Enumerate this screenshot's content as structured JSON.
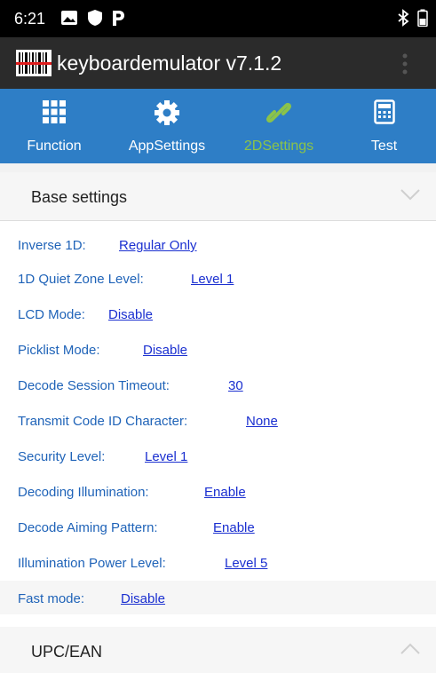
{
  "status_bar": {
    "time": "6:21"
  },
  "app_bar": {
    "title": "keyboardemulator v7.1.2"
  },
  "tabs": [
    {
      "label": "Function",
      "icon": "grid-icon",
      "active": false
    },
    {
      "label": "AppSettings",
      "icon": "gear-icon",
      "active": false
    },
    {
      "label": "2DSettings",
      "icon": "link-icon",
      "active": true
    },
    {
      "label": "Test",
      "icon": "calculator-icon",
      "active": false
    }
  ],
  "sections": [
    {
      "title": "Base settings",
      "expanded": true
    },
    {
      "title": "UPC/EAN",
      "expanded": false
    }
  ],
  "settings": [
    {
      "label": "Inverse 1D:",
      "value": "Regular Only"
    },
    {
      "label": "1D Quiet Zone Level:",
      "value": "Level 1"
    },
    {
      "label": "LCD Mode:",
      "value": "Disable"
    },
    {
      "label": "Picklist Mode:",
      "value": "Disable"
    },
    {
      "label": "Decode Session Timeout:",
      "value": "30"
    },
    {
      "label": "Transmit Code ID Character:",
      "value": "None"
    },
    {
      "label": "Security Level:",
      "value": "Level 1"
    },
    {
      "label": "Decoding Illumination:",
      "value": "Enable"
    },
    {
      "label": "Decode Aiming Pattern:",
      "value": "Enable"
    },
    {
      "label": "Illumination Power Level:",
      "value": "Level 5"
    },
    {
      "label": "Fast mode:",
      "value": "Disable"
    }
  ],
  "colors": {
    "tab_bar": "#2e7ec6",
    "active_tab": "#8bc34a",
    "link": "#1a2fd0",
    "label": "#1f63b8"
  }
}
